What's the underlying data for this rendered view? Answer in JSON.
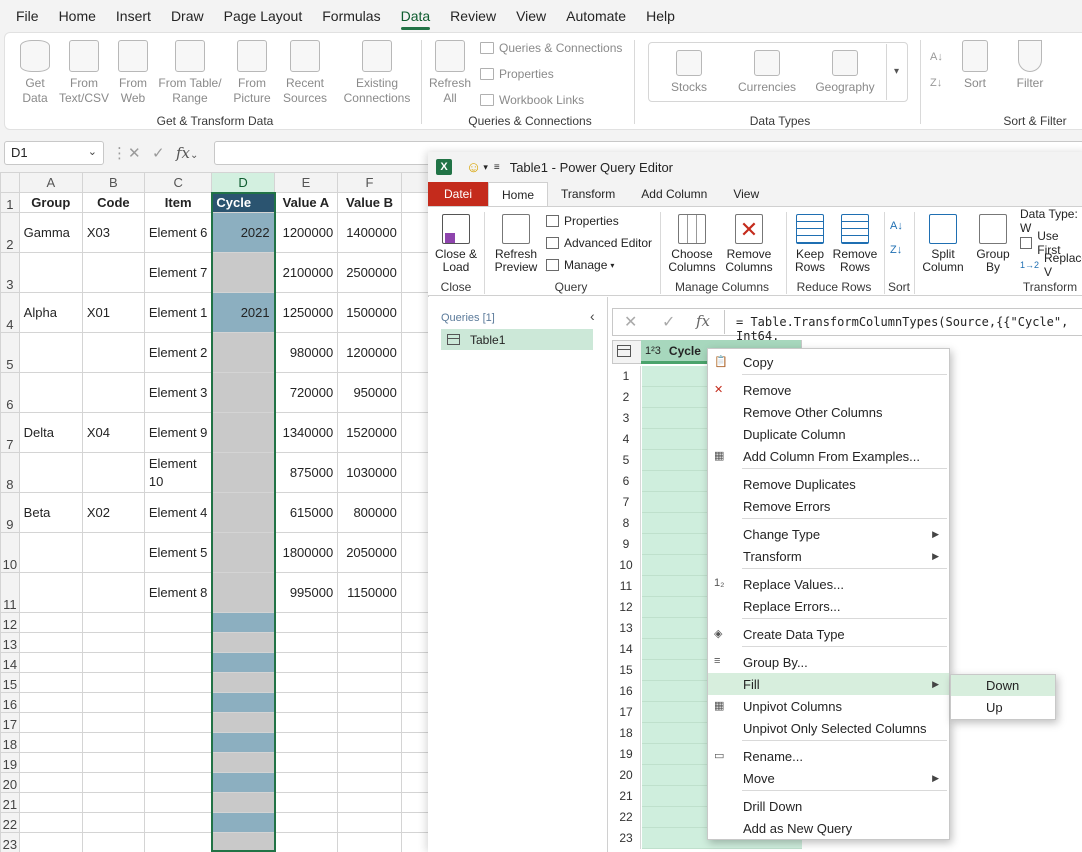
{
  "menubar": [
    "File",
    "Home",
    "Insert",
    "Draw",
    "Page Layout",
    "Formulas",
    "Data",
    "Review",
    "View",
    "Automate",
    "Help"
  ],
  "ribbon": {
    "get_data": "Get\nData",
    "from_text": "From\nText/CSV",
    "from_web": "From\nWeb",
    "from_table": "From Table/\nRange",
    "from_picture": "From\nPicture",
    "recent_sources": "Recent\nSources",
    "existing_connections": "Existing\nConnections",
    "group_get": "Get & Transform Data",
    "refresh_all": "Refresh\nAll",
    "queries_connections": "Queries & Connections",
    "properties": "Properties",
    "workbook_links": "Workbook Links",
    "group_queries": "Queries & Connections",
    "stocks": "Stocks",
    "currencies": "Currencies",
    "geography": "Geography",
    "group_datatypes": "Data Types",
    "sort": "Sort",
    "filter": "Filter",
    "group_sortfilter": "Sort & Filter"
  },
  "namebox": "D1",
  "fx": "fx",
  "sheet": {
    "col_headers": [
      "A",
      "B",
      "C",
      "D",
      "E",
      "F"
    ],
    "table_headers": [
      "Group",
      "Code",
      "Item",
      "Cycle",
      "Value A",
      "Value B"
    ],
    "rows": [
      {
        "n": "2",
        "a": "Gamma",
        "b": "X03",
        "c": "Element 6",
        "d": "2022",
        "e": "1200000",
        "f": "1400000"
      },
      {
        "n": "3",
        "a": "",
        "b": "",
        "c": "Element 7",
        "d": "",
        "e": "2100000",
        "f": "2500000"
      },
      {
        "n": "4",
        "a": "Alpha",
        "b": "X01",
        "c": "Element 1",
        "d": "2021",
        "e": "1250000",
        "f": "1500000"
      },
      {
        "n": "5",
        "a": "",
        "b": "",
        "c": "Element 2",
        "d": "",
        "e": "980000",
        "f": "1200000"
      },
      {
        "n": "6",
        "a": "",
        "b": "",
        "c": "Element 3",
        "d": "",
        "e": "720000",
        "f": "950000"
      },
      {
        "n": "7",
        "a": "Delta",
        "b": "X04",
        "c": "Element 9",
        "d": "",
        "e": "1340000",
        "f": "1520000"
      },
      {
        "n": "8",
        "a": "",
        "b": "",
        "c": "Element 10",
        "d": "",
        "e": "875000",
        "f": "1030000"
      },
      {
        "n": "9",
        "a": "Beta",
        "b": "X02",
        "c": "Element 4",
        "d": "",
        "e": "615000",
        "f": "800000"
      },
      {
        "n": "10",
        "a": "",
        "b": "",
        "c": "Element 5",
        "d": "",
        "e": "1800000",
        "f": "2050000"
      },
      {
        "n": "11",
        "a": "",
        "b": "",
        "c": "Element 8",
        "d": "",
        "e": "995000",
        "f": "1150000"
      }
    ],
    "empty_rows": [
      "12",
      "13",
      "14",
      "15",
      "16",
      "17",
      "18",
      "19",
      "20",
      "21",
      "22",
      "23"
    ]
  },
  "pq": {
    "title": "Table1 - Power Query Editor",
    "tabs": [
      "Datei",
      "Home",
      "Transform",
      "Add Column",
      "View"
    ],
    "close_load": "Close &\nLoad",
    "refresh_preview": "Refresh\nPreview",
    "properties": "Properties",
    "advanced_editor": "Advanced Editor",
    "manage": "Manage",
    "choose_columns": "Choose\nColumns",
    "remove_columns": "Remove\nColumns",
    "keep_rows": "Keep\nRows",
    "remove_rows": "Remove\nRows",
    "split_column": "Split\nColumn",
    "group_by": "Group\nBy",
    "data_type": "Data Type: W",
    "use_first": "Use First",
    "replace": "Replace V",
    "groups": [
      "Close",
      "Query",
      "Manage Columns",
      "Reduce Rows",
      "Sort",
      "Transform"
    ],
    "queries_header": "Queries [1]",
    "query_item": "Table1",
    "formula": "= Table.TransformColumnTypes(Source,{{\"Cycle\", Int64.",
    "column_type": "1²3",
    "column_name": "Cycle",
    "row_numbers": [
      "1",
      "2",
      "3",
      "4",
      "5",
      "6",
      "7",
      "8",
      "9",
      "10",
      "11",
      "12",
      "13",
      "14",
      "15",
      "16",
      "17",
      "18",
      "19",
      "20",
      "21",
      "22",
      "23"
    ]
  },
  "context_menu": {
    "items": [
      "Copy",
      "Remove",
      "Remove Other Columns",
      "Duplicate Column",
      "Add Column From Examples...",
      "Remove Duplicates",
      "Remove Errors",
      "Change Type",
      "Transform",
      "Replace Values...",
      "Replace Errors...",
      "Create Data Type",
      "Group By...",
      "Fill",
      "Unpivot Columns",
      "Unpivot Only Selected Columns",
      "Rename...",
      "Move",
      "Drill Down",
      "Add as New Query"
    ],
    "submenu": [
      "Down",
      "Up"
    ]
  }
}
